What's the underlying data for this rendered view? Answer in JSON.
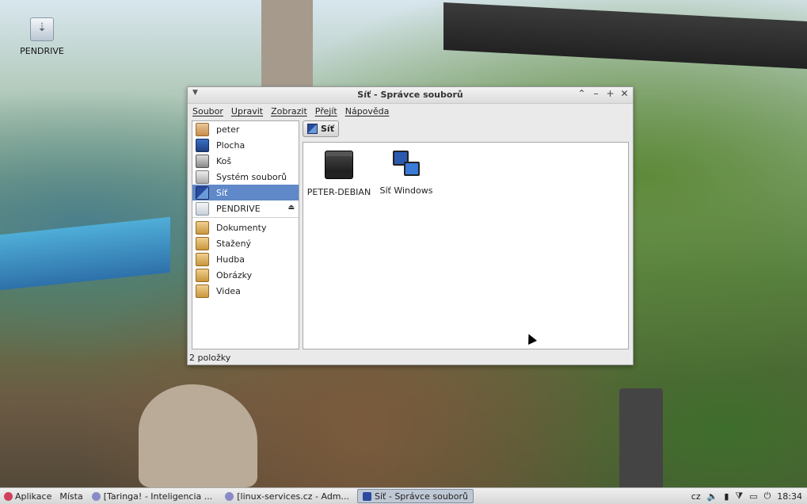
{
  "desktop": {
    "icon_label": "PENDRIVE"
  },
  "window": {
    "title": "Síť - Správce souborů",
    "menu": [
      "Soubor",
      "Upravit",
      "Zobrazit",
      "Přejít",
      "Nápověda"
    ],
    "sidebar": {
      "places": [
        {
          "label": "peter",
          "icon": "home-folder-icon"
        },
        {
          "label": "Plocha",
          "icon": "desktop-icon"
        },
        {
          "label": "Koš",
          "icon": "trash-icon"
        },
        {
          "label": "Systém souborů",
          "icon": "filesystem-icon"
        },
        {
          "label": "Síť",
          "icon": "network-icon",
          "selected": true
        },
        {
          "label": "PENDRIVE",
          "icon": "usb-drive-icon",
          "eject": true
        }
      ],
      "bookmarks": [
        {
          "label": "Dokumenty",
          "icon": "folder-documents-icon"
        },
        {
          "label": "Stažený",
          "icon": "folder-downloads-icon"
        },
        {
          "label": "Hudba",
          "icon": "folder-music-icon"
        },
        {
          "label": "Obrázky",
          "icon": "folder-pictures-icon"
        },
        {
          "label": "Videa",
          "icon": "folder-videos-icon"
        }
      ]
    },
    "path_button": "Síť",
    "files": [
      {
        "label": "PETER-DEBIAN",
        "icon": "server-icon"
      },
      {
        "label": "Síť Windows",
        "icon": "windows-network-icon"
      }
    ],
    "status": "2 položky"
  },
  "taskbar": {
    "apps_label": "Aplikace",
    "places_label": "Místa",
    "tasks": [
      {
        "label": "[Taringa! - Inteligencia ...",
        "active": false
      },
      {
        "label": "[linux-services.cz - Adm...",
        "active": false
      },
      {
        "label": "Síť - Správce souborů",
        "active": true
      }
    ],
    "keyboard_layout": "cz",
    "clock": "18:34"
  }
}
